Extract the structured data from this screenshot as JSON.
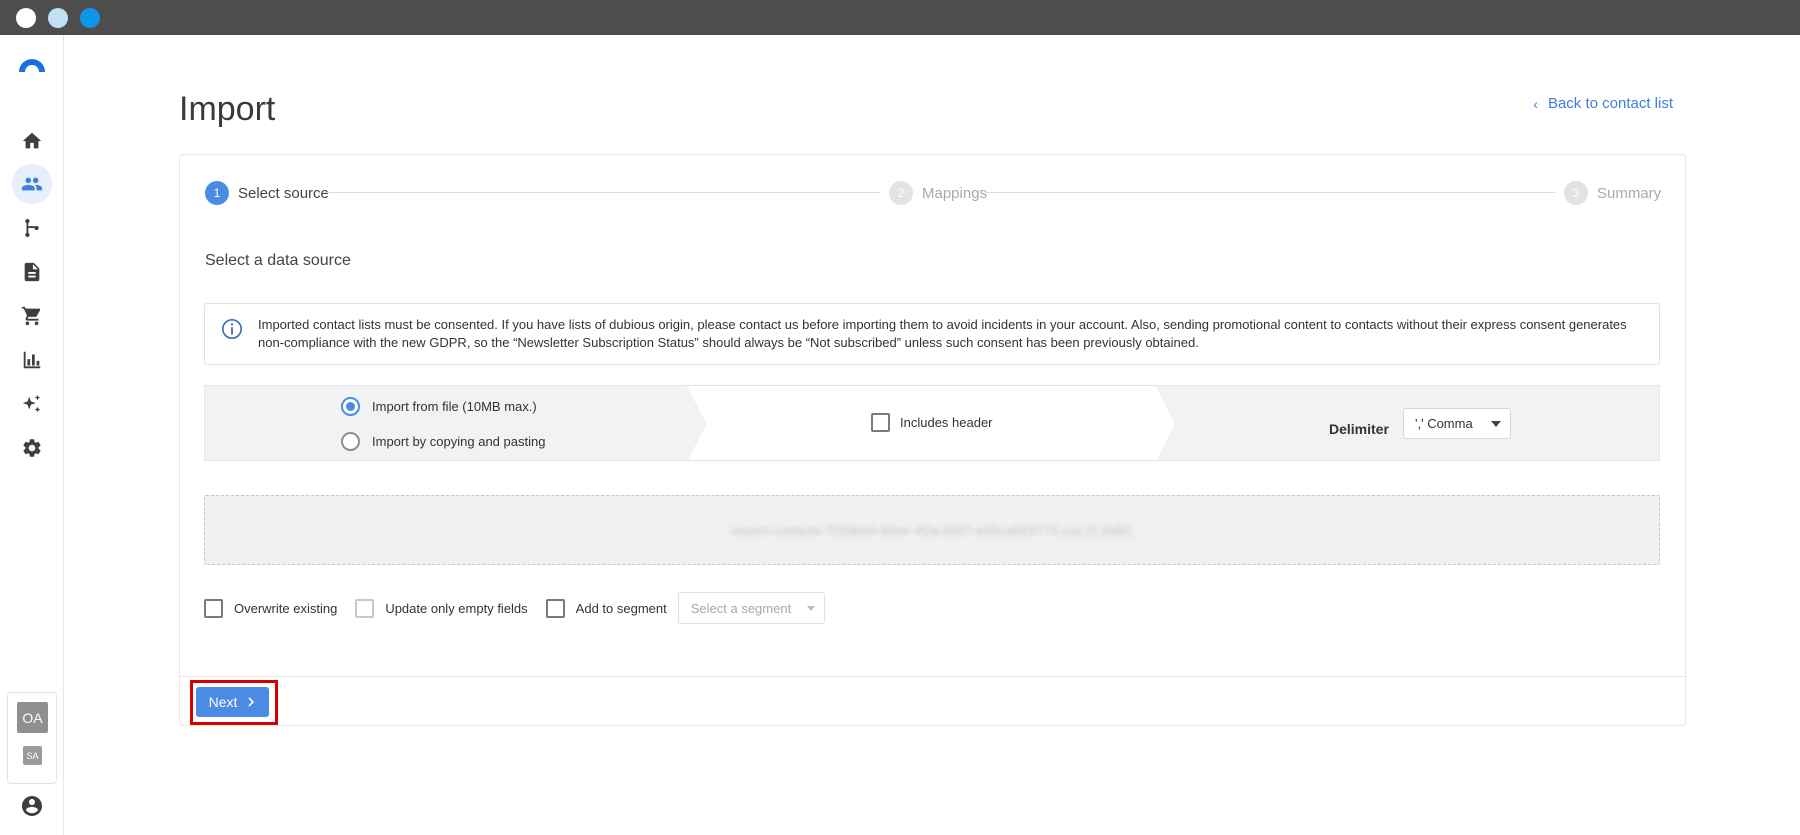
{
  "window": {
    "controls": [
      "close-dot",
      "minimize-dot",
      "maximize-dot"
    ]
  },
  "sidebar": {
    "items": [
      {
        "name": "home-icon",
        "active": false
      },
      {
        "name": "contacts-icon",
        "active": true
      },
      {
        "name": "flows-icon",
        "active": false
      },
      {
        "name": "document-icon",
        "active": false
      },
      {
        "name": "cart-icon",
        "active": false
      },
      {
        "name": "reports-icon",
        "active": false
      },
      {
        "name": "sparkles-icon",
        "active": false
      },
      {
        "name": "gear-icon",
        "active": false
      }
    ],
    "accounts": {
      "primary": "OA",
      "secondary": "SA"
    },
    "accent_color": "#3f7fd9"
  },
  "header": {
    "title": "Import",
    "back_link": "Back to contact list"
  },
  "stepper": {
    "steps": [
      {
        "number": "1",
        "label": "Select source",
        "state": "active"
      },
      {
        "number": "2",
        "label": "Mappings",
        "state": "pending"
      },
      {
        "number": "3",
        "label": "Summary",
        "state": "pending"
      }
    ]
  },
  "source": {
    "section_title": "Select a data source",
    "info_text": "Imported contact lists must be consented. If you have lists of dubious origin, please contact us before importing them to avoid incidents in your account. Also, sending promotional content to contacts without their express consent generates non-compliance with the new GDPR, so the “Newsletter Subscription Status” should always be “Not subscribed” unless such consent has been previously obtained.",
    "radio_file": "Import from file (10MB max.)",
    "radio_file_selected": true,
    "radio_paste": "Import by copying and pasting",
    "radio_paste_selected": false,
    "includes_header": "Includes header",
    "includes_header_checked": false,
    "delimiter_label": "Delimiter",
    "delimiter_value": "',' Comma",
    "file_name": "export-contacts-7059be0-80ae-4f2a-b587-e58ca663f775.csv (5.0MB)"
  },
  "options": {
    "overwrite": "Overwrite existing",
    "overwrite_checked": false,
    "update_empty": "Update only empty fields",
    "update_empty_checked": false,
    "add_segment": "Add to segment",
    "add_segment_checked": false,
    "segment_placeholder": "Select a segment"
  },
  "footer": {
    "next_label": "Next",
    "primary_color": "#4b8be3",
    "highlight_color": "#d40000"
  }
}
